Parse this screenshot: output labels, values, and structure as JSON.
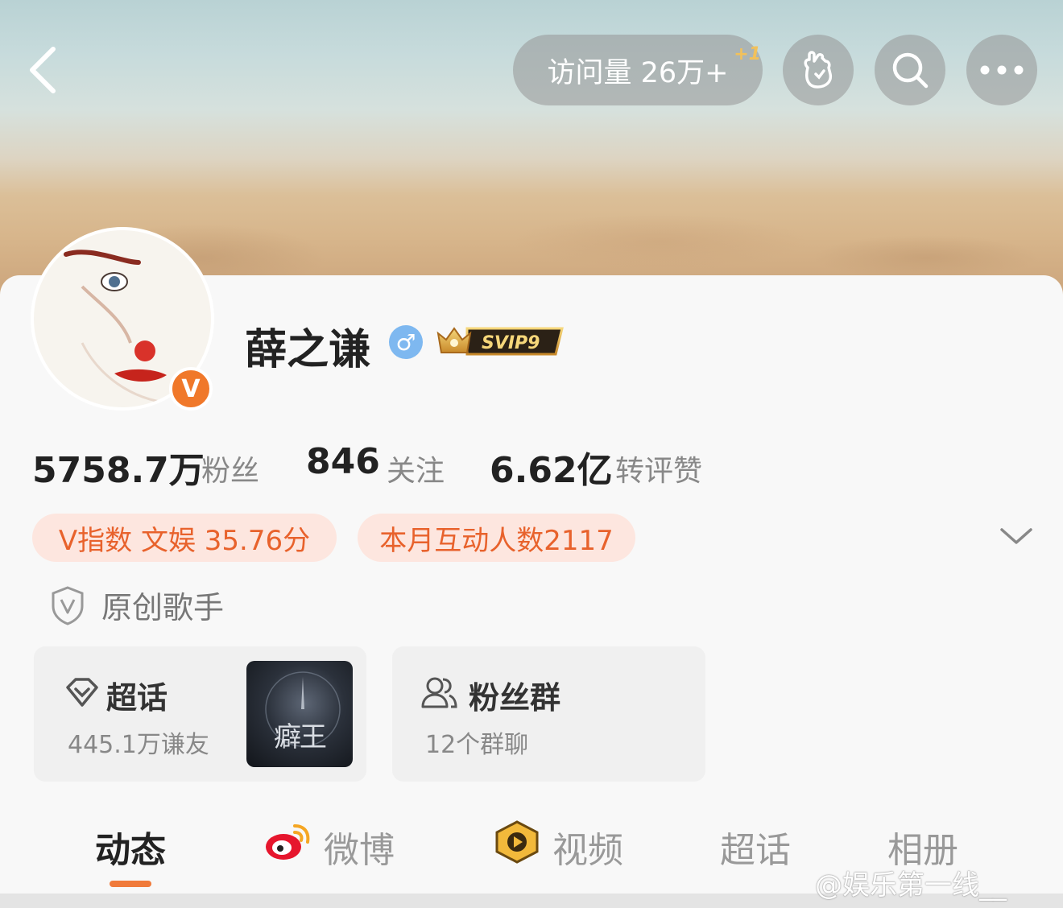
{
  "header": {
    "visits_label": "访问量 26万+",
    "visits_bonus": "+1"
  },
  "profile": {
    "name": "薛之谦",
    "gender_symbol": "♂",
    "svip_label": "SVIP9",
    "verified_badge": "V"
  },
  "stats": [
    {
      "value": "5758.7万",
      "label": "粉丝"
    },
    {
      "value": "846",
      "label": "关注"
    },
    {
      "value": "6.62亿",
      "label": "转评赞"
    }
  ],
  "pills": {
    "v_index": "V指数  文娱  35.76分",
    "interactions": "本月互动人数2117"
  },
  "tag": "原创歌手",
  "supertopic": {
    "title": "超话",
    "subtitle": "445.1万谦友",
    "thumb_text": "癖王"
  },
  "fangroup": {
    "title": "粉丝群",
    "subtitle": "12个群聊"
  },
  "tabs": [
    "动态",
    "微博",
    "视频",
    "超话",
    "相册"
  ],
  "watermark": "@娱乐第一线__",
  "colors": {
    "accent": "#f07a3a",
    "pill_bg": "#fde6df",
    "pill_text": "#e8622c",
    "verified": "#f0782a"
  }
}
